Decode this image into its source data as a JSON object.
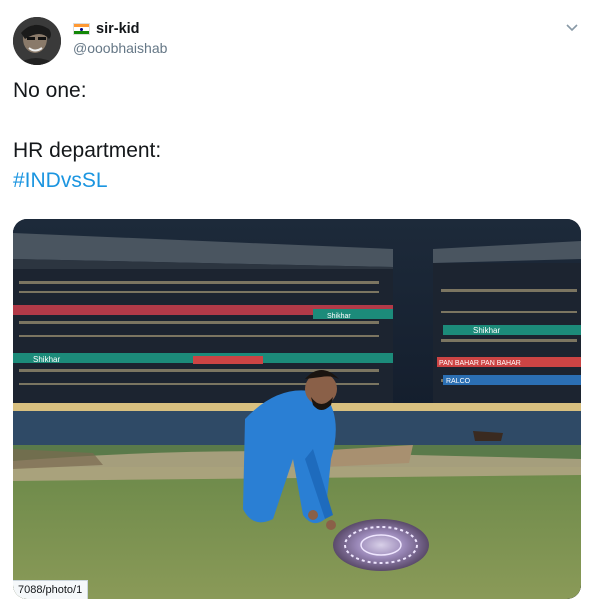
{
  "tweet": {
    "author": {
      "display_name": "sir-kid",
      "handle": "@ooobhaishab",
      "avatar_icon": "avatar-photo",
      "flag_icon": "india-flag-icon"
    },
    "menu_icon": "chevron-down-icon",
    "text": {
      "line1": "No one:",
      "line2": "",
      "line3": "HR department:",
      "hashtag": "#INDvsSL"
    },
    "photo": {
      "alt_icon": "stadium-photo",
      "banner_texts": [
        "Shikhar",
        "Shikhar",
        "Shikhar",
        "RALCO",
        "PAN BAHAR PAN BAHAR"
      ]
    },
    "status_url": "7088/photo/1"
  },
  "colors": {
    "hashtag": "#1b95e0",
    "text": "#14171a",
    "secondary": "#657786"
  }
}
